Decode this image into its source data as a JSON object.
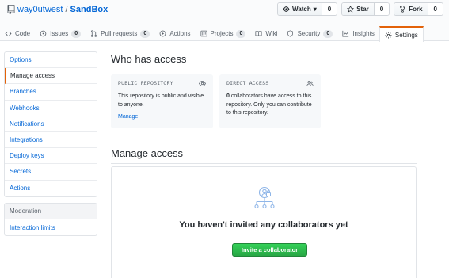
{
  "repo": {
    "owner": "way0utwest",
    "separator": "/",
    "name": "SandBox"
  },
  "actions": [
    {
      "label": "Watch",
      "caret": "▾",
      "count": "0"
    },
    {
      "label": "Star",
      "count": "0"
    },
    {
      "label": "Fork",
      "count": "0"
    }
  ],
  "tabs": [
    {
      "label": "Code"
    },
    {
      "label": "Issues",
      "count": "0"
    },
    {
      "label": "Pull requests",
      "count": "0"
    },
    {
      "label": "Actions"
    },
    {
      "label": "Projects",
      "count": "0"
    },
    {
      "label": "Wiki"
    },
    {
      "label": "Security",
      "count": "0"
    },
    {
      "label": "Insights"
    },
    {
      "label": "Settings"
    }
  ],
  "sidebar": {
    "items": [
      {
        "label": "Options"
      },
      {
        "label": "Manage access"
      },
      {
        "label": "Branches"
      },
      {
        "label": "Webhooks"
      },
      {
        "label": "Notifications"
      },
      {
        "label": "Integrations"
      },
      {
        "label": "Deploy keys"
      },
      {
        "label": "Secrets"
      },
      {
        "label": "Actions"
      }
    ],
    "moderation": {
      "heading": "Moderation",
      "items": [
        {
          "label": "Interaction limits"
        }
      ]
    }
  },
  "main": {
    "who_title": "Who has access",
    "public_box": {
      "title": "PUBLIC REPOSITORY",
      "text": "This repository is public and visible to anyone.",
      "link": "Manage"
    },
    "direct_box": {
      "title": "DIRECT ACCESS",
      "count": "0",
      "text": " collaborators have access to this repository. Only you can contribute to this repository."
    },
    "manage_title": "Manage access",
    "blank_title": "You haven't invited any collaborators yet",
    "invite_label": "Invite a collaborator"
  },
  "colors": {
    "accent": "#e36209",
    "link": "#0366d6",
    "primary": "#28a745"
  }
}
